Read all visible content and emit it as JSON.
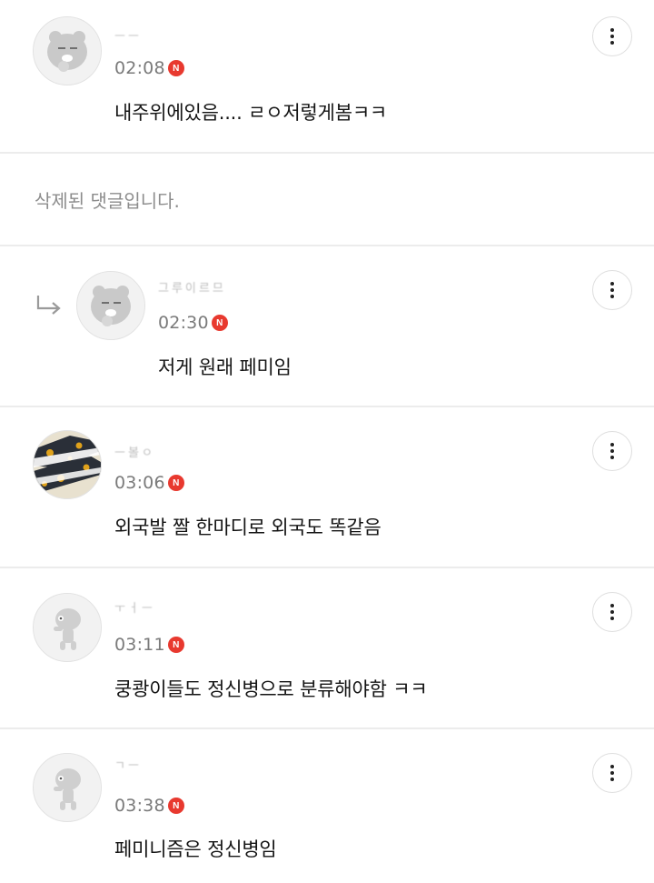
{
  "comments": [
    {
      "nickname": "ㅡㅡ",
      "time": "02:08",
      "badge": "N",
      "text": "내주위에있음.... ㄹㅇ저렇게봄ㅋㅋ",
      "avatar_icon": "ryan-character-icon",
      "is_reply": false
    },
    {
      "deleted_text": "삭제된 댓글입니다."
    },
    {
      "nickname": "그루이르므",
      "time": "02:30",
      "badge": "N",
      "text": "저게 원래 페미임",
      "avatar_icon": "ryan-character-icon",
      "is_reply": true,
      "reply_icon": "reply-arrow-icon"
    },
    {
      "nickname": "ㅡ볼ㅇ",
      "time": "03:06",
      "badge": "N",
      "text": "외국발 짤 한마디로 외국도 똑같음",
      "avatar_icon": "pattern-photo-avatar",
      "is_reply": false
    },
    {
      "nickname": "ㅜㅓㅡ",
      "time": "03:11",
      "badge": "N",
      "text": "쿵쾅이들도 정신병으로 분류해야함 ㅋㅋ",
      "avatar_icon": "default-character-icon",
      "is_reply": false
    },
    {
      "nickname": "ㄱㅡ",
      "time": "03:38",
      "badge": "N",
      "text": "페미니즘은 정신병임",
      "avatar_icon": "default-character-icon",
      "is_reply": false
    }
  ],
  "colors": {
    "badge": "#e8392f",
    "time": "#7a7a7a",
    "deleted": "#8c8c8c",
    "divider": "#ececec"
  },
  "more_icon": "more-vertical-icon"
}
